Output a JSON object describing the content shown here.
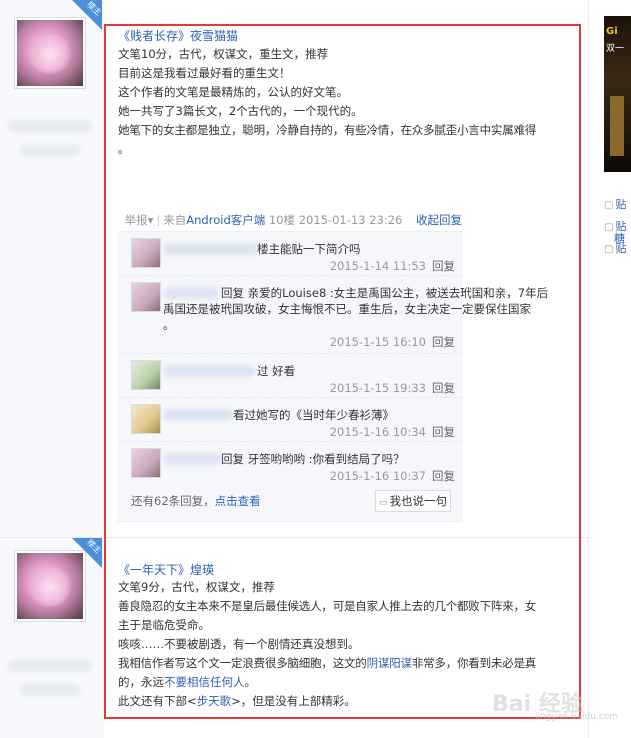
{
  "post1": {
    "badge": "楼主",
    "title_book": "《贱者长存》",
    "title_author": "夜雪猫猫",
    "lines": [
      "文笔10分，古代，权谋文，重生文，推荐",
      "目前这是我看过最好看的重生文！",
      "这个作者的文笔是最精炼的，公认的好文笔。",
      "她一共写了3篇长文，2个古代的，一个现代的。",
      "她笔下的女主都是独立，聪明，冷静自持的，有些冷情，在众多腻歪小言中实属难得",
      "。"
    ],
    "meta": {
      "report": "举报",
      "report_arrow": "▾",
      "source_prefix": "来自",
      "source_link": "Android客户端",
      "floor": "10楼",
      "datetime": "2015-01-13 23:26",
      "collapse": "收起回复"
    },
    "replies": [
      {
        "text": "楼主能贴一下简介吗",
        "time": "2015-1-14 11:53",
        "reply": "回复"
      },
      {
        "text_line1": "回复 亲爱的Louise8 :女主是禹国公主，被送去玳国和亲，7年后",
        "text_line2": "禹国还是被玳国攻破，女主悔恨不已。重生后，女主决定一定要保住国家",
        "text_line3": "。",
        "time": "2015-1-15 16:10",
        "reply": "回复"
      },
      {
        "text": "过 好看",
        "time": "2015-1-15 19:33",
        "reply": "回复"
      },
      {
        "text": "看过她写的《当时年少春衫薄》",
        "time": "2015-1-16 10:34",
        "reply": "回复"
      },
      {
        "text": "回复 牙签哟哟哟 :你看到结局了吗？",
        "time": "2015-1-16 10:37",
        "reply": "回复"
      }
    ],
    "more_prefix": "还有62条回复，",
    "more_link": "点击查看",
    "say_button": "我也说一句"
  },
  "post2": {
    "badge": "楼主",
    "title_book": "《一年天下》",
    "title_author": "煌瑛",
    "line1": "文笔9分，古代，权谋文，推荐",
    "line2": "善良隐忍的女主本来不是皇后最佳候选人，可是自家人推上去的几个都败下阵来，女",
    "line3": "主于是临危受命。",
    "line4": "咳咳……不要被剧透，有一个剧情还真没想到。",
    "line5_a": "我相信作者写这个文一定浪费很多脑细胞，这文的",
    "line5_link": "阴谋阳谋",
    "line5_b": "非常多，你看到未必是真",
    "line6_a": "的，永远",
    "line6_link": "不要相信任何人",
    "line6_b": "。",
    "line7_a": "此文还有下部<",
    "line7_link": "步天歌",
    "line7_b": ">，但是没有上部精彩。"
  },
  "sidebar": {
    "ad_line1": "Gi",
    "ad_line2": "双一",
    "links": [
      "贴",
      "贴",
      "糖",
      "贴"
    ]
  },
  "watermark": {
    "main": "Bai 经验",
    "sub": "jingyan.baidu.com"
  }
}
